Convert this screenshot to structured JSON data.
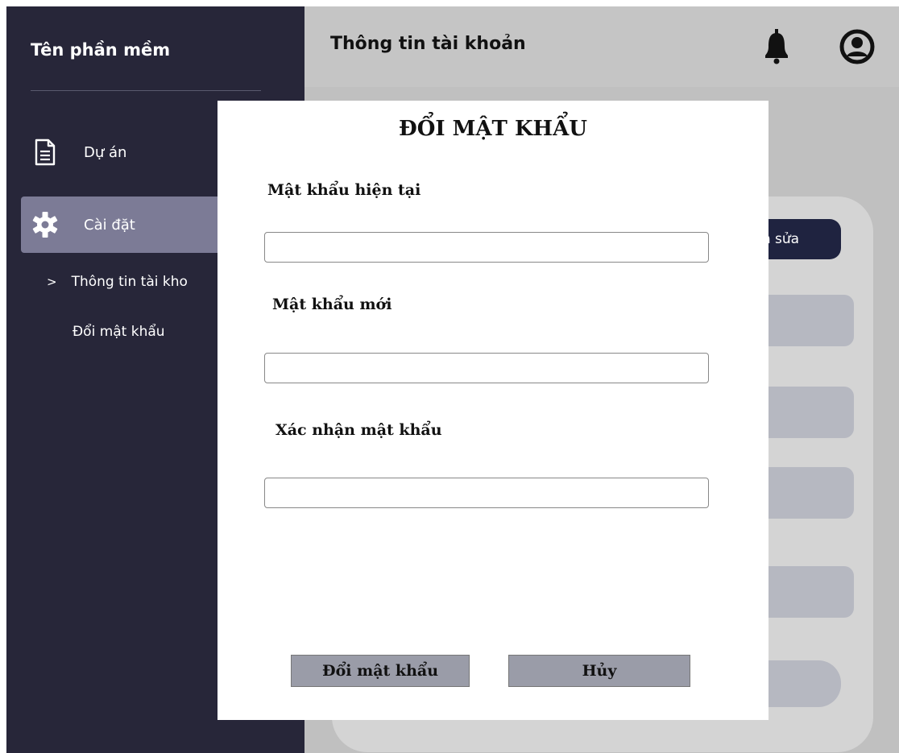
{
  "sidebar": {
    "app_name": "Tên phần mềm",
    "items": [
      {
        "label": "Dự án",
        "icon": "document-icon"
      },
      {
        "label": "Cài đặt",
        "icon": "gear-icon"
      }
    ],
    "subitems": [
      {
        "label": "Thông tin tài kho"
      },
      {
        "label": "Đổi mật khẩu"
      }
    ],
    "chevron": ">"
  },
  "header": {
    "title": "Thông tin tài khoản",
    "icons": [
      "bell-icon",
      "user-icon"
    ]
  },
  "main": {
    "edit_button_label": "h sửa"
  },
  "modal": {
    "title": "ĐỔI MẬT KHẨU",
    "fields": [
      {
        "label": "Mật khẩu hiện tại",
        "value": ""
      },
      {
        "label": "Mật khẩu mới",
        "value": ""
      },
      {
        "label": "Xác nhận mật khẩu",
        "value": ""
      }
    ],
    "submit_label": "Đổi mật khẩu",
    "cancel_label": "Hủy"
  },
  "colors": {
    "sidebar_bg": "#272639",
    "active_item_bg": "#7c7b96",
    "header_bg": "#c5c5c5",
    "button_gray": "#9a9ca8",
    "edit_button_bg": "#1f2340"
  }
}
